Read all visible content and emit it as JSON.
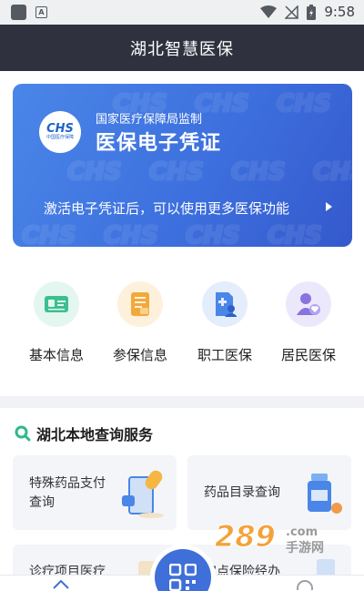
{
  "status_bar": {
    "time": "9:58",
    "notification_letter": "A"
  },
  "header": {
    "title": "湖北智慧医保"
  },
  "banner": {
    "logo_text": "CHS",
    "logo_sub": "中国医疗保障",
    "supervisor": "国家医疗保障局监制",
    "title": "医保电子凭证",
    "activate_text": "激活电子凭证后，可以使用更多医保功能"
  },
  "quick_actions": [
    {
      "label": "基本信息",
      "icon": "id-card-icon",
      "color": "#3bbf8f",
      "bg": "#e3f6ef"
    },
    {
      "label": "参保信息",
      "icon": "insurance-doc-icon",
      "color": "#f2a93b",
      "bg": "#fdf1dc"
    },
    {
      "label": "职工医保",
      "icon": "employee-medical-icon",
      "color": "#4a86e8",
      "bg": "#e4edfc"
    },
    {
      "label": "居民医保",
      "icon": "resident-medical-icon",
      "color": "#8a72e0",
      "bg": "#ece8fb"
    }
  ],
  "services": {
    "title": "湖北本地查询服务",
    "tiles": [
      {
        "label_line1": "特殊药品支付",
        "label_line2": "查询",
        "icon": "pill-phone-icon"
      },
      {
        "label_line1": "药品目录查询",
        "label_line2": "",
        "icon": "medicine-bottle-icon"
      },
      {
        "label_line1": "诊疗项目医疗",
        "label_line2": "",
        "icon": "treatment-icon"
      },
      {
        "label_line1": "定点保险经办",
        "label_line2": "",
        "icon": "agency-icon"
      }
    ]
  },
  "watermark": {
    "text": "289",
    "sub": "手游网",
    "suffix": ".com"
  },
  "colors": {
    "header_bg": "#2f323e",
    "card_start": "#4a86e8",
    "card_end": "#3559cc",
    "accent": "#3f6fd8",
    "search_green": "#2fb88a"
  }
}
